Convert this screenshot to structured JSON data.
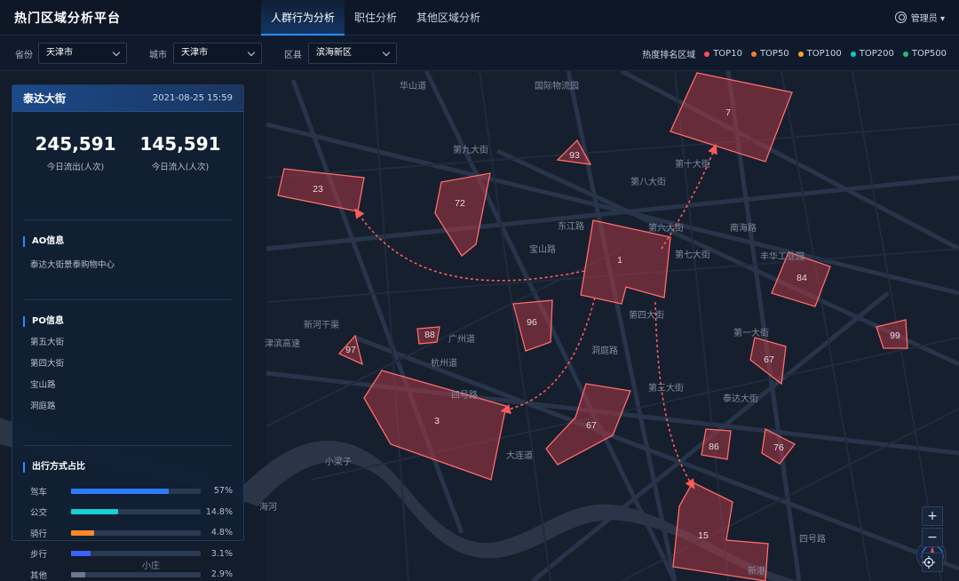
{
  "header": {
    "brand": "热门区域分析平台",
    "tabs": [
      {
        "label": "人群行为分析",
        "active": true
      },
      {
        "label": "职住分析",
        "active": false
      },
      {
        "label": "其他区域分析",
        "active": false
      }
    ],
    "user": "管理员 ▾"
  },
  "filters": {
    "province_label": "省份",
    "province_value": "天津市",
    "city_label": "城市",
    "city_value": "天津市",
    "district_label": "区县",
    "district_value": "滨海新区"
  },
  "legend": {
    "title": "热度排名区域",
    "items": [
      {
        "label": "TOP10",
        "color": "#ff4d5a"
      },
      {
        "label": "TOP50",
        "color": "#ff7a2e"
      },
      {
        "label": "TOP100",
        "color": "#f5a623"
      },
      {
        "label": "TOP200",
        "color": "#16c6c8"
      },
      {
        "label": "TOP500",
        "color": "#1dbf73"
      }
    ]
  },
  "panel": {
    "title": "泰达大街",
    "datetime": "2021-08-25   15:59",
    "outflow_value": "245,591",
    "outflow_label": "今日流出(人次)",
    "inflow_value": "145,591",
    "inflow_label": "今日流入(人次)",
    "ao_title": "AO信息",
    "ao_text": "泰达大街景泰购物中心",
    "po_title": "PO信息",
    "po_items": [
      "第五大街",
      "第四大街",
      "宝山路",
      "洞庭路"
    ],
    "travel_title": "出行方式占比",
    "travel": [
      {
        "label": "驾车",
        "value": "57%",
        "ratio": 0.75,
        "color": "#2f7bff"
      },
      {
        "label": "公交",
        "value": "14.8%",
        "ratio": 0.36,
        "color": "#17d1d4"
      },
      {
        "label": "骑行",
        "value": "4.8%",
        "ratio": 0.18,
        "color": "#ff8a2a"
      },
      {
        "label": "步行",
        "value": "3.1%",
        "ratio": 0.15,
        "color": "#3d63ff"
      },
      {
        "label": "其他",
        "value": "2.9%",
        "ratio": 0.11,
        "color": "#6b7a90"
      }
    ]
  },
  "map": {
    "region_labels": [
      "1",
      "3",
      "7",
      "15",
      "23",
      "67",
      "67",
      "72",
      "76",
      "84",
      "86",
      "88",
      "93",
      "96",
      "97",
      "99"
    ],
    "place_labels": [
      "国际物流园",
      "第九大街",
      "第八大街",
      "第七大街",
      "第十大街",
      "丰华工业园",
      "东江路",
      "宝山路",
      "广州道",
      "杭州道",
      "四号路",
      "大连道",
      "小梁子",
      "新河干渠",
      "津滨高速",
      "海河",
      "泰达大街",
      "第三大街",
      "第四大街",
      "第六大街",
      "洞庭路",
      "南海路",
      "新港",
      "四号路",
      "华山道",
      "小庄",
      "第一大街"
    ]
  }
}
